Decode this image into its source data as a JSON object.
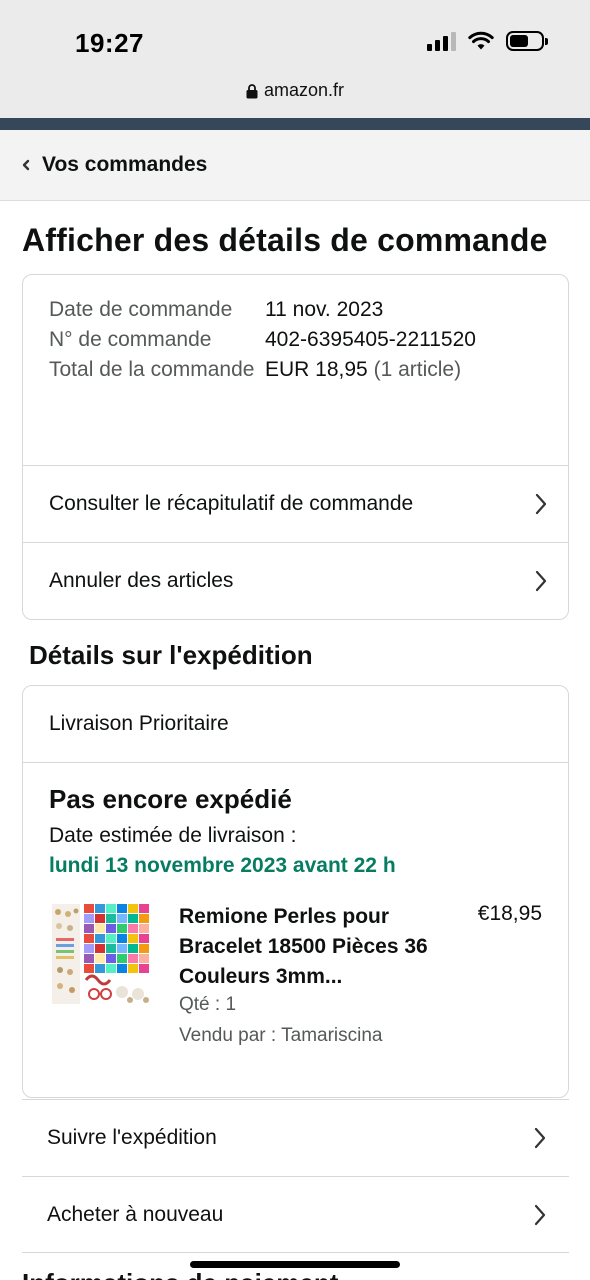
{
  "status_bar": {
    "time": "19:27"
  },
  "browser": {
    "url": "amazon.fr"
  },
  "nav": {
    "back_label": "Vos commandes"
  },
  "page": {
    "title": "Afficher des détails de commande"
  },
  "order_summary": {
    "date_label": "Date de commande",
    "date_value": "11 nov. 2023",
    "number_label": "N° de commande",
    "number_value": "402-6395405-2211520",
    "total_label": "Total de la commande",
    "total_value": "EUR 18,95",
    "total_items": "(1 article)",
    "links": [
      {
        "label": "Consulter le récapitulatif de commande"
      },
      {
        "label": "Annuler des articles"
      }
    ]
  },
  "shipping": {
    "section_title": "Détails sur l'expédition",
    "method": "Livraison Prioritaire",
    "status": "Pas encore expédié",
    "estimate_label": "Date estimée de livraison :",
    "estimate_date": "lundi 13 novembre 2023 avant 22 h",
    "product": {
      "name": "Remione Perles pour Bracelet 18500 Pièces 36 Couleurs 3mm...",
      "price": "€18,95",
      "quantity": "Qté : 1",
      "seller": "Vendu par : Tamariscina"
    },
    "actions": [
      {
        "label": "Suivre l'expédition"
      },
      {
        "label": "Acheter à nouveau"
      }
    ]
  },
  "next_section_partial": "Informations de paiement",
  "colors": {
    "green_date": "#067d62",
    "navy_strip": "#37475a",
    "border": "#d5d9d9",
    "muted_text": "#565959"
  },
  "icons": [
    "lock-icon",
    "chevron-left-icon",
    "chevron-right-icon",
    "signal-icon",
    "wifi-icon",
    "battery-icon"
  ]
}
